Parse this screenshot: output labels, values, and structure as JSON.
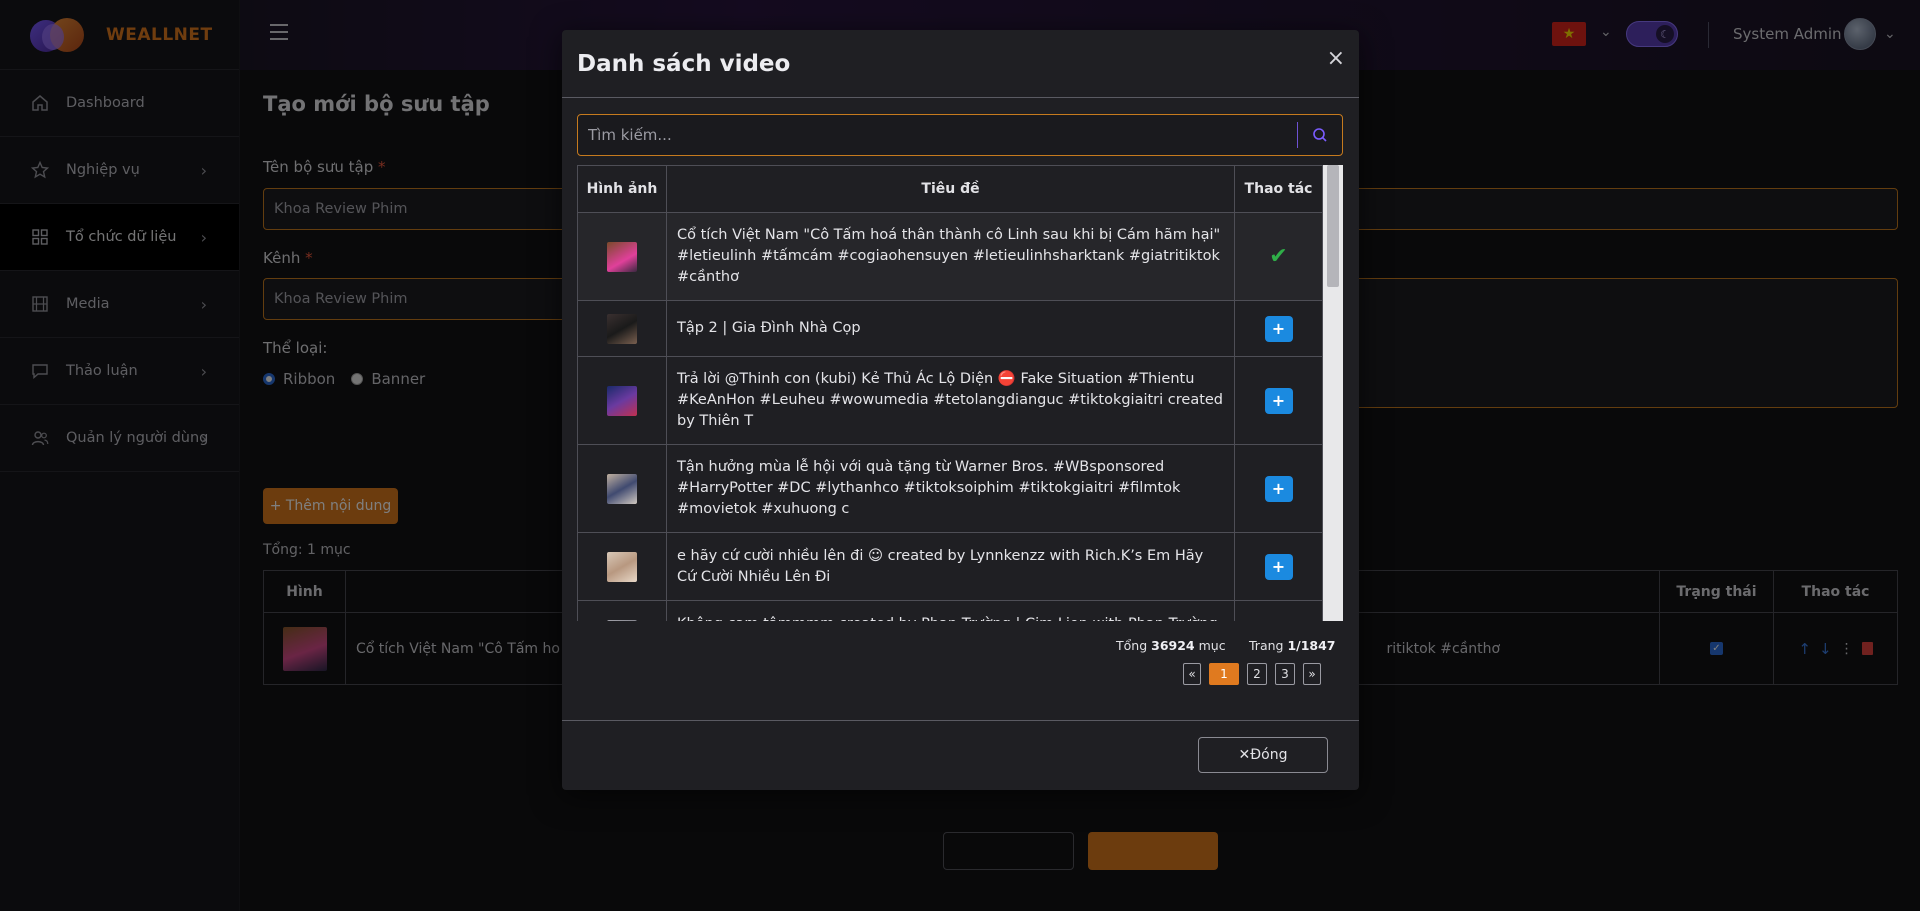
{
  "brand": {
    "name": "WEALLNET"
  },
  "sidebar": {
    "items": [
      {
        "label": "Dashboard",
        "icon": "home-icon"
      },
      {
        "label": "Nghiệp vụ",
        "icon": "star-icon"
      },
      {
        "label": "Tổ chức dữ liệu",
        "icon": "grid-icon"
      },
      {
        "label": "Media",
        "icon": "film-icon"
      },
      {
        "label": "Thảo luận",
        "icon": "chat-icon"
      },
      {
        "label": "Quản lý người dùng",
        "icon": "users-icon"
      }
    ]
  },
  "topbar": {
    "user_name": "System Admin",
    "language_flag": "vn-flag"
  },
  "form": {
    "page_title": "Tạo mới bộ sưu tập",
    "collection_name_label": "Tên bộ sưu tập",
    "collection_name_value": "Khoa Review Phim",
    "channel_label": "Kênh",
    "channel_value": "Khoa Review Phim",
    "required_mark": "*",
    "category_label": "Thể loại:",
    "category_options": [
      "Ribbon",
      "Banner"
    ],
    "category_selected": "Ribbon",
    "add_content_label": "+ Thêm nội dung",
    "total_text": "Tổng: 1 mục",
    "table_headers": {
      "image": "Hình",
      "status": "Trạng thái",
      "actions": "Thao tác"
    },
    "row_title_left": "Cổ tích Việt Nam \"Cô Tấm ho",
    "row_title_right": "ritiktok #cầnthơ"
  },
  "modal": {
    "title": "Danh sách video",
    "close_symbol": "×",
    "search_placeholder": "Tìm kiếm...",
    "headers": {
      "image": "Hình ảnh",
      "title": "Tiêu đề",
      "actions": "Thao tác"
    },
    "rows": [
      {
        "title": "Cổ tích Việt Nam \"Cô Tấm hoá thân thành cô Linh sau khi bị Cám hãm hại\" #letieulinh #tấmcám #cogiaohensuyen #letieulinhsharktank #giatritiktok #cầnthơ",
        "selected": true
      },
      {
        "title": "Tập 2 | Gia Đình Nhà Cọp",
        "selected": false
      },
      {
        "title": "Trả lời @Thinh con (kubi) Kẻ Thủ Ác Lộ Diện ⛔ Fake Situation #Thientu #KeAnHon #Leuheu #wowumedia #tetolangdianguc #tiktokgiaitri created by Thiên T",
        "selected": false
      },
      {
        "title": "Tận hưởng mùa lễ hội với quà tặng từ Warner Bros. #WBsponsored #HarryPotter #DC #lythanhco #tiktoksoiphim #tiktokgiaitri #filmtok #movietok #xuhuong c",
        "selected": false
      },
      {
        "title": "e hãy cứ cười nhiều lên đi ☺ created by Lynnkenzz with Rich.K’s Em Hãy Cứ Cười Nhiều Lên Đi",
        "selected": false
      },
      {
        "title": "Không cam tâmmmm created by Phan Trường | Cim Lion with Phan Trường |",
        "selected": false
      }
    ],
    "add_label": "+",
    "pager": {
      "total_prefix": "Tổng",
      "total_count": "36924",
      "total_suffix": "mục",
      "page_prefix": "Trang",
      "page_value": "1/1847",
      "prev": "«",
      "pages": [
        "1",
        "2",
        "3"
      ],
      "current_page": "1",
      "next": "»"
    },
    "close_button_label": "✕Đóng"
  },
  "colors": {
    "accent": "#e07a1f",
    "brand_purple": "#6e52d4",
    "add_button_blue": "#1b8ae0",
    "check_green": "#2fae48"
  }
}
